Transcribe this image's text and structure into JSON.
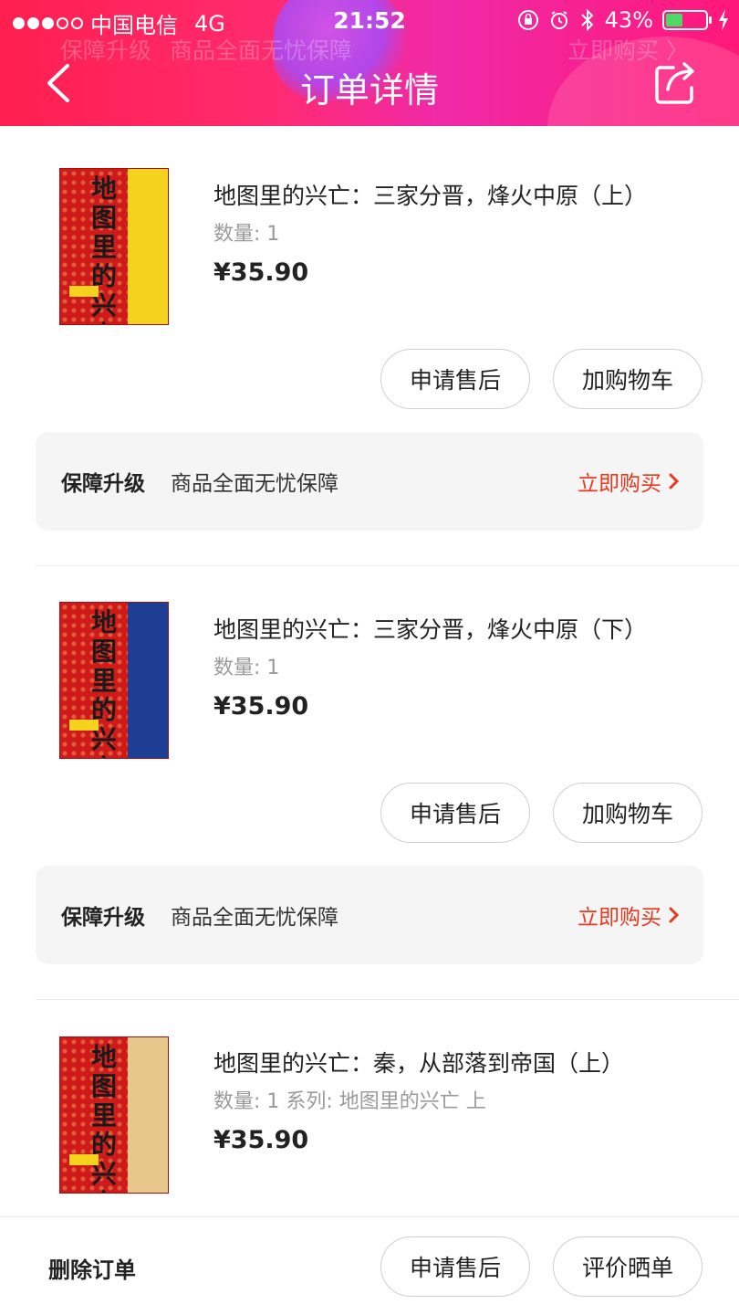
{
  "status_bar": {
    "carrier": "中国电信",
    "network": "4G",
    "time": "21:52",
    "battery": "43%",
    "battery_level": 0.43
  },
  "header": {
    "title": "订单详情",
    "ghost_guard_label": "保障升级",
    "ghost_guard_text": "商品全面无忧保障",
    "ghost_guard_action": "立即购买 〉"
  },
  "products": [
    {
      "title": "地图里的兴亡：三家分晋，烽火中原（上）",
      "qty": "数量: 1",
      "price": "¥35.90",
      "cover_band": "yellow",
      "after_sale_label": "申请售后",
      "add_cart_label": "加购物车"
    },
    {
      "title": "地图里的兴亡：三家分晋，烽火中原（下）",
      "qty": "数量: 1",
      "price": "¥35.90",
      "cover_band": "blue",
      "after_sale_label": "申请售后",
      "add_cart_label": "加购物车"
    },
    {
      "title": "地图里的兴亡：秦，从部落到帝国（上）",
      "qty": "数量: 1  系列: 地图里的兴亡 上",
      "price": "¥35.90",
      "cover_band": "tan"
    }
  ],
  "guard": [
    {
      "label": "保障升级",
      "text": "商品全面无忧保障",
      "action": "立即购买"
    },
    {
      "label": "保障升级",
      "text": "商品全面无忧保障",
      "action": "立即购买"
    }
  ],
  "cover_glyphs": "地图里的兴亡",
  "bottom_bar": {
    "delete_label": "删除订单",
    "after_sale_label": "申请售后",
    "review_label": "评价晒单"
  },
  "colors": {
    "accent_red": "#e8391e",
    "header_gradient_start": "#ff1f4f",
    "header_gradient_end": "#f02aa8"
  }
}
